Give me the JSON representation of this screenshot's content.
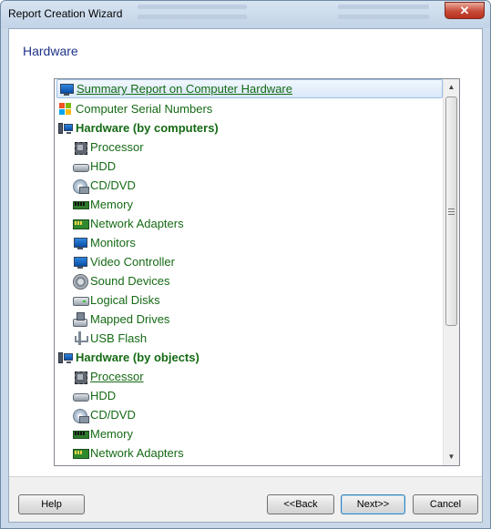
{
  "window": {
    "title": "Report Creation Wizard",
    "close_glyph": "✕"
  },
  "page": {
    "heading": "Hardware"
  },
  "tree": {
    "items": [
      {
        "label": "Summary Report on Computer Hardware",
        "icon": "monitor-icon",
        "level": 0,
        "bold": false,
        "underline": true,
        "selected": true
      },
      {
        "label": "Computer Serial Numbers",
        "icon": "windows-logo-icon",
        "level": 0,
        "bold": false,
        "underline": false,
        "selected": false
      },
      {
        "label": "Hardware (by computers)",
        "icon": "computer-icon",
        "level": 0,
        "bold": true,
        "underline": false,
        "selected": false
      },
      {
        "label": "Processor",
        "icon": "cpu-icon",
        "level": 1,
        "bold": false,
        "underline": false,
        "selected": false
      },
      {
        "label": "HDD",
        "icon": "hard-drive-icon",
        "level": 1,
        "bold": false,
        "underline": false,
        "selected": false
      },
      {
        "label": "CD/DVD",
        "icon": "cd-dvd-icon",
        "level": 1,
        "bold": false,
        "underline": false,
        "selected": false
      },
      {
        "label": "Memory",
        "icon": "memory-icon",
        "level": 1,
        "bold": false,
        "underline": false,
        "selected": false
      },
      {
        "label": "Network Adapters",
        "icon": "network-adapter-icon",
        "level": 1,
        "bold": false,
        "underline": false,
        "selected": false
      },
      {
        "label": "Monitors",
        "icon": "monitor-icon",
        "level": 1,
        "bold": false,
        "underline": false,
        "selected": false
      },
      {
        "label": "Video Controller",
        "icon": "video-controller-icon",
        "level": 1,
        "bold": false,
        "underline": false,
        "selected": false
      },
      {
        "label": "Sound Devices",
        "icon": "speaker-icon",
        "level": 1,
        "bold": false,
        "underline": false,
        "selected": false
      },
      {
        "label": "Logical Disks",
        "icon": "logical-disk-icon",
        "level": 1,
        "bold": false,
        "underline": false,
        "selected": false
      },
      {
        "label": "Mapped Drives",
        "icon": "mapped-drive-icon",
        "level": 1,
        "bold": false,
        "underline": false,
        "selected": false
      },
      {
        "label": "USB Flash",
        "icon": "usb-icon",
        "level": 1,
        "bold": false,
        "underline": false,
        "selected": false
      },
      {
        "label": "Hardware (by objects)",
        "icon": "computer-icon",
        "level": 0,
        "bold": true,
        "underline": false,
        "selected": false
      },
      {
        "label": "Processor",
        "icon": "cpu-icon",
        "level": 1,
        "bold": false,
        "underline": true,
        "selected": false
      },
      {
        "label": "HDD",
        "icon": "hard-drive-icon",
        "level": 1,
        "bold": false,
        "underline": false,
        "selected": false
      },
      {
        "label": "CD/DVD",
        "icon": "cd-dvd-icon",
        "level": 1,
        "bold": false,
        "underline": false,
        "selected": false
      },
      {
        "label": "Memory",
        "icon": "memory-icon",
        "level": 1,
        "bold": false,
        "underline": false,
        "selected": false
      },
      {
        "label": "Network Adapters",
        "icon": "network-adapter-icon",
        "level": 1,
        "bold": false,
        "underline": false,
        "selected": false
      }
    ],
    "scroll_up_glyph": "▲",
    "scroll_down_glyph": "▼"
  },
  "buttons": {
    "help": "Help",
    "back": "<<Back",
    "next": "Next>>",
    "cancel": "Cancel"
  },
  "colors": {
    "item_text": "#156a15",
    "heading": "#1e3287"
  }
}
